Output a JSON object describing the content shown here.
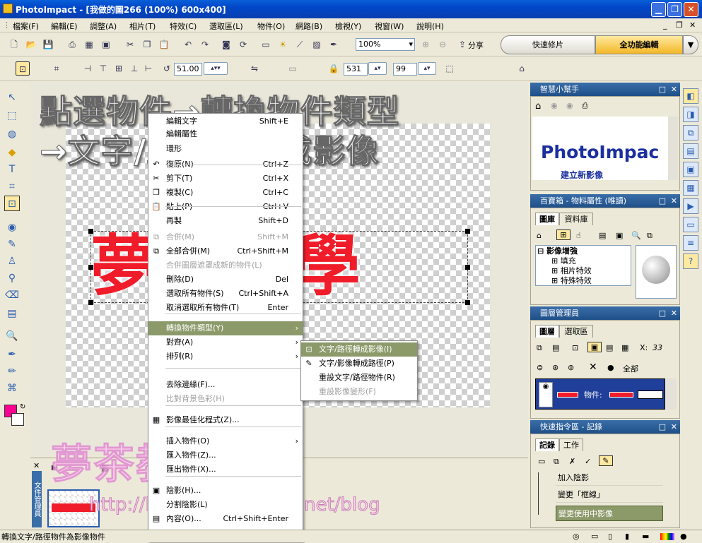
{
  "window": {
    "title": "PhotoImpact - [我做的圖266 (100%) 600x400]",
    "min": "▁",
    "max": "❐",
    "close": "✕"
  },
  "menus": [
    "檔案(F)",
    "編輯(E)",
    "調整(A)",
    "相片(T)",
    "特效(C)",
    "選取區(L)",
    "物件(O)",
    "網路(B)",
    "檢視(Y)",
    "視窗(W)",
    "說明(H)"
  ],
  "menu_right": {
    "min": "_",
    "restore": "❐",
    "close": "✕"
  },
  "toolbar1": {
    "zoom": "100%",
    "share": "分享"
  },
  "mode": {
    "quick": "快速修片",
    "full": "全功能編輯",
    "drop": "▼"
  },
  "toolbar2": {
    "angle": "51.00",
    "width": "531",
    "height": "99"
  },
  "overlay": {
    "line1": "點選物件→轉換物件類型",
    "line2": "→文字/路徑轉換成影像"
  },
  "canvas_text": "夢茶教學",
  "context_menu": {
    "top_items": [
      {
        "label": "編輯文字",
        "shortcut": "Shift+E"
      },
      {
        "label": "編輯屬性",
        "shortcut": ""
      },
      {
        "label": "環形",
        "shortcut": ""
      }
    ],
    "items": [
      {
        "label": "復原(N)",
        "shortcut": "Ctrl+Z",
        "icon": "undo-icon",
        "glyph": "↶",
        "disabled": false
      },
      {
        "label": "剪下(T)",
        "shortcut": "Ctrl+X",
        "icon": "cut-icon",
        "glyph": "✂",
        "disabled": false
      },
      {
        "label": "複製(C)",
        "shortcut": "Ctrl+C",
        "icon": "copy-icon",
        "glyph": "❐",
        "disabled": false
      },
      {
        "label": "貼上(P)",
        "shortcut": "Ctrl+V",
        "icon": "paste-icon",
        "glyph": "📋",
        "disabled": false
      },
      {
        "label": "再製",
        "shortcut": "Shift+D",
        "icon": "",
        "glyph": "",
        "disabled": false
      },
      {
        "label": "合併(M)",
        "shortcut": "Shift+M",
        "icon": "merge-icon",
        "glyph": "⧉",
        "disabled": true
      },
      {
        "label": "全部合併(M)",
        "shortcut": "Ctrl+Shift+M",
        "icon": "merge-all-icon",
        "glyph": "⧉",
        "disabled": false
      },
      {
        "label": "合併圖層遮罩成新的物件(L)",
        "shortcut": "",
        "icon": "",
        "glyph": "",
        "disabled": true
      },
      {
        "label": "刪除(D)",
        "shortcut": "Del",
        "icon": "",
        "glyph": "",
        "disabled": false
      },
      {
        "label": "選取所有物件(S)",
        "shortcut": "Ctrl+Shift+A",
        "icon": "",
        "glyph": "",
        "disabled": false
      },
      {
        "label": "取消選取所有物件(T)",
        "shortcut": "Enter",
        "icon": "",
        "glyph": "",
        "disabled": false
      },
      {
        "label": "轉換物件類型(Y)",
        "shortcut": "",
        "icon": "",
        "glyph": "",
        "disabled": false,
        "submenu": true,
        "highlighted": true
      },
      {
        "label": "對齊(A)",
        "shortcut": "",
        "icon": "",
        "glyph": "",
        "disabled": false,
        "submenu": true
      },
      {
        "label": "排列(R)",
        "shortcut": "",
        "icon": "",
        "glyph": "",
        "disabled": false,
        "submenu": true
      },
      {
        "label": "去除邊緣(F)...",
        "shortcut": "",
        "icon": "",
        "glyph": "",
        "disabled": false
      },
      {
        "label": "比對背景色彩(H)",
        "shortcut": "",
        "icon": "",
        "glyph": "",
        "disabled": true
      },
      {
        "label": "影像最佳化程式(Z)...",
        "shortcut": "",
        "icon": "optimizer-icon",
        "glyph": "▦",
        "disabled": false
      },
      {
        "label": "插入物件(O)",
        "shortcut": "",
        "icon": "",
        "glyph": "",
        "disabled": false,
        "submenu": true
      },
      {
        "label": "匯入物件(Z)...",
        "shortcut": "",
        "icon": "",
        "glyph": "",
        "disabled": false
      },
      {
        "label": "匯出物件(X)...",
        "shortcut": "",
        "icon": "",
        "glyph": "",
        "disabled": false
      },
      {
        "label": "陰影(H)...",
        "shortcut": "",
        "icon": "shadow-icon",
        "glyph": "▣",
        "disabled": false
      },
      {
        "label": "分割陰影(L)",
        "shortcut": "",
        "icon": "",
        "glyph": "",
        "disabled": false
      },
      {
        "label": "內容(O)...",
        "shortcut": "Ctrl+Shift+Enter",
        "icon": "properties-icon",
        "glyph": "▤",
        "disabled": false
      }
    ]
  },
  "submenu": {
    "items": [
      {
        "label": "文字/路徑轉成影像(I)",
        "icon": "text-to-image-icon",
        "glyph": "⊡",
        "disabled": false,
        "highlighted": true
      },
      {
        "label": "文字/影像轉成路徑(P)",
        "icon": "to-path-icon",
        "glyph": "✎",
        "disabled": false
      },
      {
        "label": "重設文字/路徑物件(R)",
        "icon": "",
        "glyph": "",
        "disabled": false
      },
      {
        "label": "重設影像變形(F)",
        "icon": "",
        "glyph": "",
        "disabled": true
      }
    ]
  },
  "panels": {
    "helper": {
      "title": "智慧小幫手",
      "brand": "PhotoImpac",
      "sub": "建立新影像"
    },
    "library": {
      "title": "百寶箱 - 物料屬性 (唯讀)",
      "tabs": [
        "圖庫",
        "資料庫"
      ],
      "tree": [
        "⊟ 影像增強",
        "⊞ 填充",
        "⊞ 相片特效",
        "⊞ 特殊特效"
      ]
    },
    "layers": {
      "title": "圖層管理員",
      "tabs": [
        "圖層",
        "選取區"
      ],
      "x_label": "X:",
      "x_value": "33",
      "all": "全部",
      "object": "物件:"
    },
    "quick_cmd": {
      "title": "快速指令區 - 記錄",
      "tabs": [
        "記錄",
        "工作"
      ],
      "history": [
        "加入陰影",
        "變更「框線」",
        "變更使用中影像"
      ]
    }
  },
  "docmgr": {
    "label": "文件管理員",
    "tab_label": "影"
  },
  "watermark": {
    "text": "夢茶教學",
    "url": "http://kelly1688.pixnet.net/blog"
  },
  "status": {
    "text": "轉換文字/路徑物件為影像物件"
  }
}
